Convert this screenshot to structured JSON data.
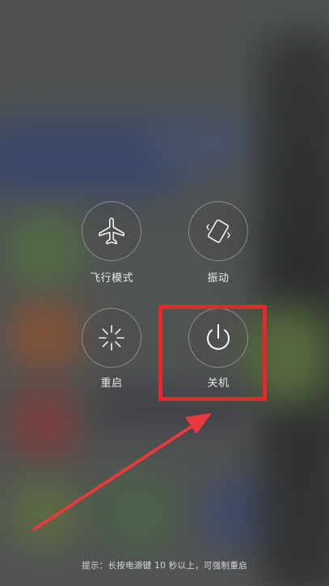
{
  "menu": {
    "items": [
      {
        "id": "airplane",
        "label": "飞行模式",
        "icon": "airplane-icon"
      },
      {
        "id": "vibrate",
        "label": "振动",
        "icon": "vibrate-phone-icon"
      },
      {
        "id": "reboot",
        "label": "重启",
        "icon": "reboot-spinner-icon"
      },
      {
        "id": "shutdown",
        "label": "关机",
        "icon": "power-icon"
      }
    ]
  },
  "hint": "提示：长按电源键 10 秒以上，可强制重启",
  "annotation": {
    "box_color": "#e8262c",
    "arrow_color": "#e83a3a"
  }
}
